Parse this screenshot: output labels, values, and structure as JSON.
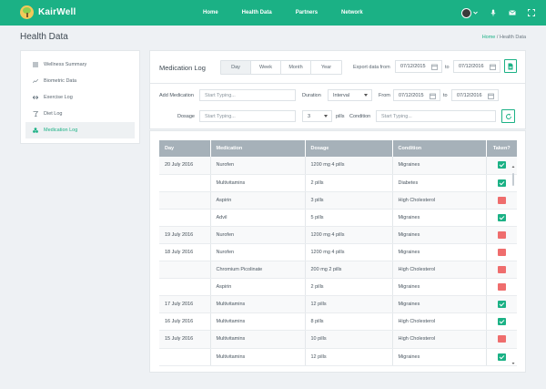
{
  "app": {
    "name": "KairWell"
  },
  "nav": {
    "items": [
      "Home",
      "Health Data",
      "Partners",
      "Network"
    ]
  },
  "header": {
    "title": "Health Data",
    "breadcrumb": {
      "home": "Home",
      "separator": "/",
      "current": "Health Data"
    }
  },
  "sidebar": {
    "items": [
      {
        "label": "Wellness Summary",
        "icon": "list-icon"
      },
      {
        "label": "Biometric Data",
        "icon": "trend-line-icon"
      },
      {
        "label": "Exercise Log",
        "icon": "exercise-icon"
      },
      {
        "label": "Diet Log",
        "icon": "diet-icon"
      },
      {
        "label": "Medication Log",
        "icon": "medication-icon",
        "active": true
      }
    ]
  },
  "medlog": {
    "title": "Medication Log",
    "periods": [
      "Day",
      "Week",
      "Month",
      "Year"
    ],
    "active_period": "Day",
    "export_label": "Export data from",
    "date_from": "07/12/2015",
    "to_label": "to",
    "date_to": "07/12/2016"
  },
  "filter": {
    "add_label": "Add Medication",
    "medication_placeholder": "Start Typing...",
    "duration_label": "Duration",
    "duration_value": "Interval",
    "from_label": "From",
    "from_date": "07/12/2015",
    "to_label": "to",
    "to_date": "07/12/2016",
    "dosage_label": "Dosage",
    "dosage_placeholder": "Start Typing...",
    "pills_count": "3",
    "pills_label": "pills",
    "condition_label": "Condition",
    "condition_placeholder": "Start Typing..."
  },
  "table": {
    "columns": [
      "Day",
      "Medication",
      "Dosage",
      "Condition",
      "Taken?"
    ],
    "rows": [
      [
        "20 July 2016",
        "Nurofen",
        "1200 mg   4 pills",
        "Migraines",
        true
      ],
      [
        "",
        "Multivitamins",
        "2 pills",
        "Diabetes",
        true
      ],
      [
        "",
        "Aspirin",
        "3 pills",
        "High Cholesterol",
        false
      ],
      [
        "",
        "Advil",
        "5 pills",
        "Migraines",
        true
      ],
      [
        "19 July 2016",
        "Nurofen",
        "1200 mg   4 pills",
        "Migraines",
        false
      ],
      [
        "18 July 2016",
        "Nurofen",
        "1200 mg   4 pills",
        "Migraines",
        false
      ],
      [
        "",
        "Chromium Picolinate",
        "200 mg   2 pills",
        "High Cholesterol",
        false
      ],
      [
        "",
        "Aspirin",
        "2 pills",
        "Migraines",
        false
      ],
      [
        "17 July 2016",
        "Multivitamins",
        "12 pills",
        "Migraines",
        true
      ],
      [
        "16 July 2016",
        "Multivitamins",
        "8 pills",
        "High Cholesterol",
        true
      ],
      [
        "15 July 2016",
        "Multivitamins",
        "10 pills",
        "High Cholesterol",
        false
      ],
      [
        "",
        "Multivitamins",
        "12 pills",
        "Migraines",
        true
      ]
    ]
  },
  "colors": {
    "brand": "#1bb185",
    "taken_yes": "#1bb185",
    "taken_no": "#ef6d6d",
    "table_header": "#a6b1b9"
  }
}
